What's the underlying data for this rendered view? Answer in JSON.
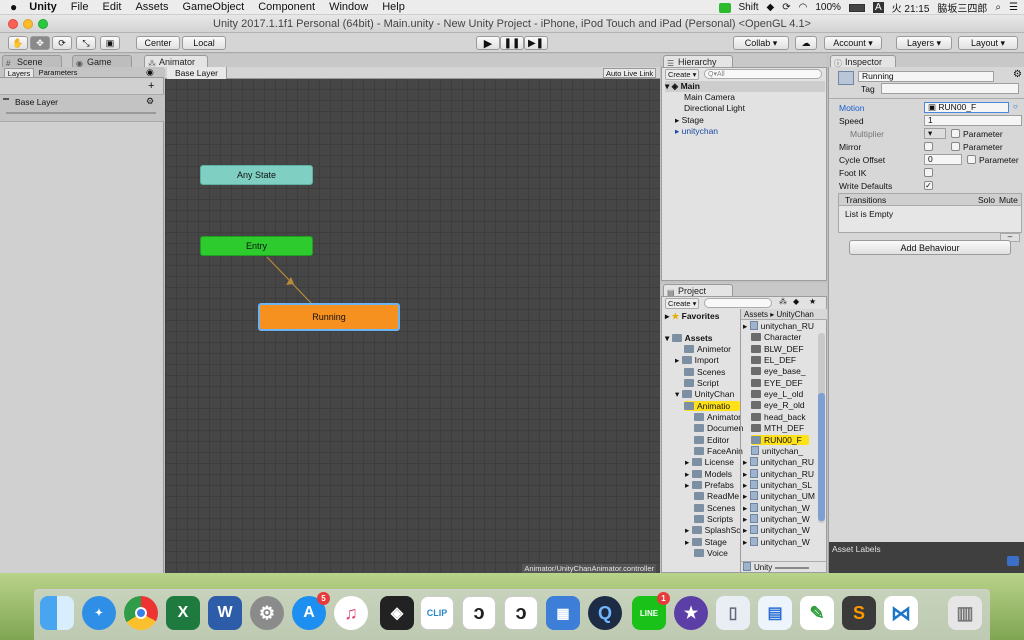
{
  "menubar": {
    "apple": "",
    "items": [
      "Unity",
      "File",
      "Edit",
      "Assets",
      "GameObject",
      "Component",
      "Window",
      "Help"
    ],
    "status": [
      "Shift",
      "100%",
      "A",
      "火 21:15",
      "脇坂三四郎"
    ]
  },
  "window": {
    "title": "Unity 2017.1.1f1 Personal (64bit) - Main.unity - New Unity Project - iPhone, iPod Touch and iPad (Personal) <OpenGL 4.1>"
  },
  "toolbar": {
    "pivot_center": "Center",
    "pivot_local": "Local",
    "collab": "Collab ▾",
    "account": "Account",
    "layers": "Layers",
    "layout": "Layout"
  },
  "tabs": {
    "scene": "Scene",
    "game": "Game",
    "animator": "Animator",
    "hierarchy": "Hierarchy",
    "project": "Project",
    "inspector": "Inspector"
  },
  "animator": {
    "sub_tabs": [
      "Layers",
      "Parameters"
    ],
    "breadcrumb": "Base Layer",
    "auto_live_link": "Auto Live Link",
    "layer_name": "Base Layer",
    "path": "Animator/UnityChanAnimator.controller",
    "nodes": {
      "any_state": "Any State",
      "entry": "Entry",
      "running": "Running"
    }
  },
  "hierarchy": {
    "create": "Create ▾",
    "search_placeholder": "Q▾All",
    "scene": "Main",
    "items": [
      "Main Camera",
      "Directional Light",
      "Stage",
      "unitychan"
    ]
  },
  "project": {
    "create": "Create ▾",
    "favorites": "Favorites",
    "assets": "Assets",
    "folders": [
      "Animetor",
      "Import",
      "Scenes",
      "Script"
    ],
    "unitychan": "UnityChan",
    "unitychan_children": [
      "Animatio",
      "Animator",
      "Documen",
      "Editor",
      "FaceAnin",
      "License",
      "Models",
      "Prefabs",
      "ReadMe",
      "Scenes",
      "Scripts",
      "SplashSc",
      "Stage",
      "Voice"
    ],
    "breadcrumb": [
      "Assets",
      "UnityChan"
    ],
    "files": [
      "unitychan_RU",
      "Character",
      "BLW_DEF",
      "EL_DEF",
      "eye_base_",
      "EYE_DEF",
      "eye_L_old",
      "eye_R_old",
      "head_back",
      "MTH_DEF",
      "RUN00_F",
      "unitychan_",
      "unitychan_RU",
      "unitychan_RU",
      "unitychan_SL",
      "unitychan_UM",
      "unitychan_W",
      "unitychan_W",
      "unitychan_W",
      "unitychan_W"
    ],
    "footer": "Unity"
  },
  "inspector": {
    "name": "Running",
    "tag_label": "Tag",
    "motion_label": "Motion",
    "motion_value": "RUN00_F",
    "speed_label": "Speed",
    "speed_value": "1",
    "multiplier_label": "Multiplier",
    "parameter_label": "Parameter",
    "mirror_label": "Mirror",
    "cycle_offset_label": "Cycle Offset",
    "cycle_offset_value": "0",
    "foot_ik_label": "Foot IK",
    "write_defaults_label": "Write Defaults",
    "transitions_label": "Transitions",
    "solo_label": "Solo",
    "mute_label": "Mute",
    "list_empty": "List is Empty",
    "add_behaviour": "Add Behaviour",
    "asset_labels": "Asset Labels"
  },
  "dock": {
    "icons": [
      "finder-icon",
      "safari-icon",
      "chrome-icon",
      "excel-icon",
      "word-icon",
      "system-preferences-icon",
      "app-store-icon",
      "itunes-icon",
      "unity-icon",
      "clip-studio-icon",
      "clip-studio-paint-icon",
      "clip-studio-2-icon",
      "slides-icon",
      "quicktime-icon",
      "line-icon",
      "imovie-icon",
      "preview-icon",
      "keynote-icon",
      "evernote-icon",
      "sublime-icon",
      "vscode-icon",
      "trash-icon"
    ],
    "app_store_badge": "5",
    "line_badge": "1",
    "excel": "X",
    "word": "W",
    "clip": "CLIP"
  }
}
